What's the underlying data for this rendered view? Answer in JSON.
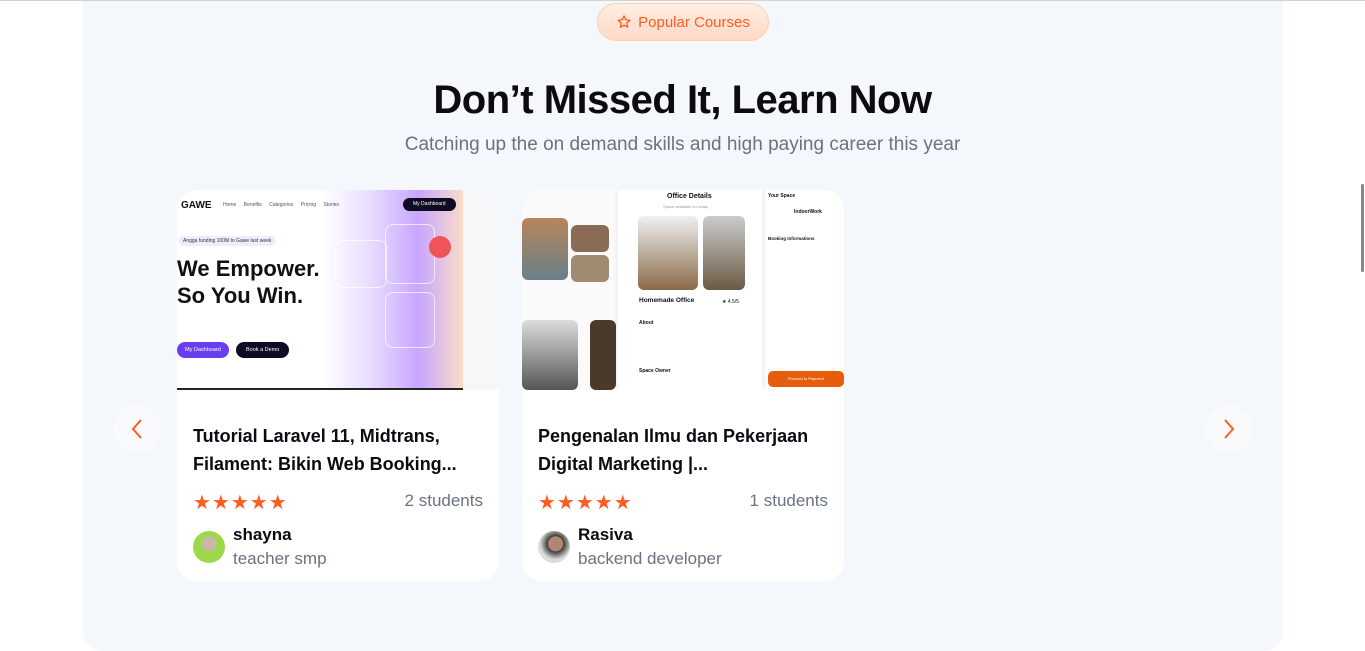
{
  "badge": {
    "label": "Popular Courses",
    "icon": "star-outline-icon"
  },
  "heading": "Don’t Missed It, Learn Now",
  "subheading": "Catching up the on demand skills and high paying career this year",
  "colors": {
    "accent": "#ff5c1f",
    "section_bg": "#f4f7fb",
    "text": "#0b0b12",
    "muted": "#6b7280"
  },
  "courses": [
    {
      "title": "Tutorial Laravel 11, Midtrans, Filament: Bikin Web Booking...",
      "rating": 5,
      "stars": "★★★★★",
      "students": "2 students",
      "teacher": {
        "name": "shayna",
        "role": "teacher smp"
      },
      "thumbnail": {
        "logo": "GAWE",
        "nav": [
          "Home",
          "Benefits",
          "Categories",
          "Pricing",
          "Stories"
        ],
        "cta": "My Dashboard",
        "headline1": "We Empower.",
        "headline2": "So You Win.",
        "btn1": "My Dashboard",
        "btn2": "Book a Demo",
        "tag": "Angga funding 100M to Gawe last week"
      }
    },
    {
      "title": "Pengenalan Ilmu dan Pekerjaan Digital Marketing |...",
      "rating": 5,
      "stars": "★★★★★",
      "students": "1 students",
      "teacher": {
        "name": "Rasiva",
        "role": "backend developer"
      },
      "thumbnail": {
        "screen_title": "Office Details",
        "screen_sub": "Space available for today",
        "place": "Homemade Office",
        "score": "4.5/5",
        "about": "About",
        "owner": "Space Owner",
        "your_space": "Your Space",
        "space_name": "IndoorWork",
        "booking": "Booking Informations",
        "pay": "Proceed to Payment"
      }
    }
  ],
  "nav": {
    "prev": "chevron-left-icon",
    "next": "chevron-right-icon"
  }
}
